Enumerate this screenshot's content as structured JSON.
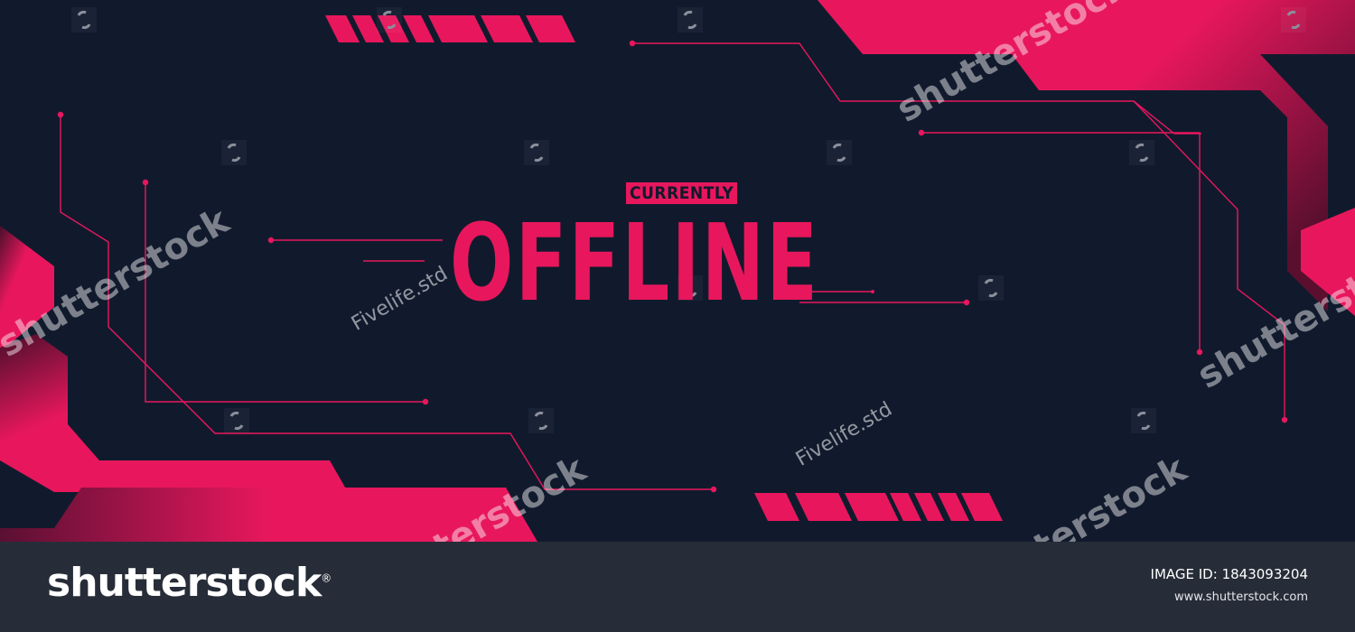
{
  "banner": {
    "eyebrow": "CURRENTLY",
    "headline": "OFFLINE",
    "accent_color": "#e8175d",
    "background_color": "#111a2d"
  },
  "watermarks": {
    "brand": "shutterstock",
    "artist": "Fivelife.std",
    "icon": "shutterstock-logo-icon"
  },
  "footer": {
    "logo_text": "shutterstock",
    "logo_mark": "®",
    "image_id_label": "IMAGE ID:",
    "image_id_value": "1843093204",
    "website": "www.shutterstock.com"
  }
}
